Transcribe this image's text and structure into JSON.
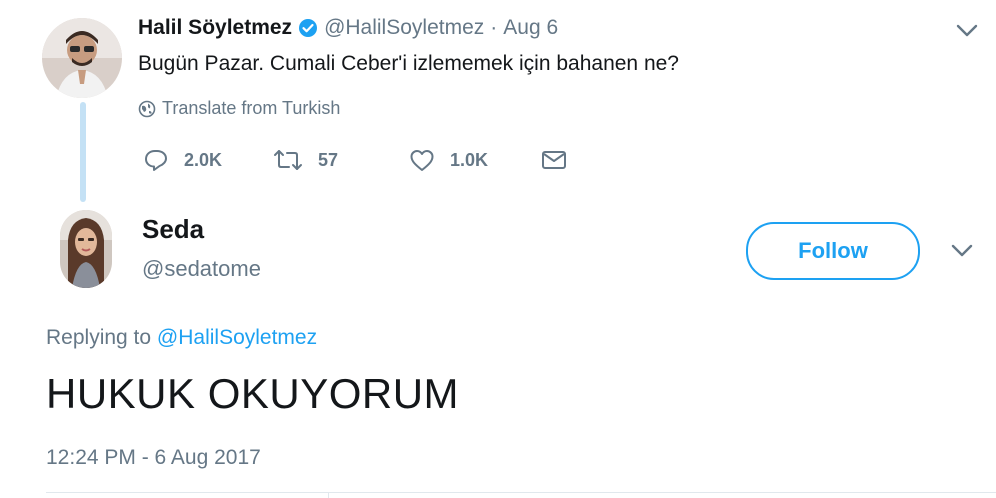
{
  "original_tweet": {
    "author_name": "Halil Söyletmez",
    "author_handle": "@HalilSoyletmez",
    "separator": "·",
    "date": "Aug 6",
    "text": "Bugün Pazar. Cumali Ceber'i izlememek için bahanen ne?",
    "translate_label": "Translate from Turkish",
    "actions": {
      "replies": "2.0K",
      "retweets": "57",
      "likes": "1.0K"
    }
  },
  "reply_tweet": {
    "author_name": "Seda",
    "author_handle": "@sedatome",
    "follow_label": "Follow",
    "replying_prefix": "Replying to",
    "replying_to": "@HalilSoyletmez",
    "text": "HUKUK OKUYORUM",
    "timestamp": "12:24 PM - 6 Aug 2017"
  },
  "colors": {
    "accent": "#1da1f2",
    "secondary_text": "#657786",
    "verified": "#1da1f2",
    "thread_line": "#c4e1f5"
  }
}
